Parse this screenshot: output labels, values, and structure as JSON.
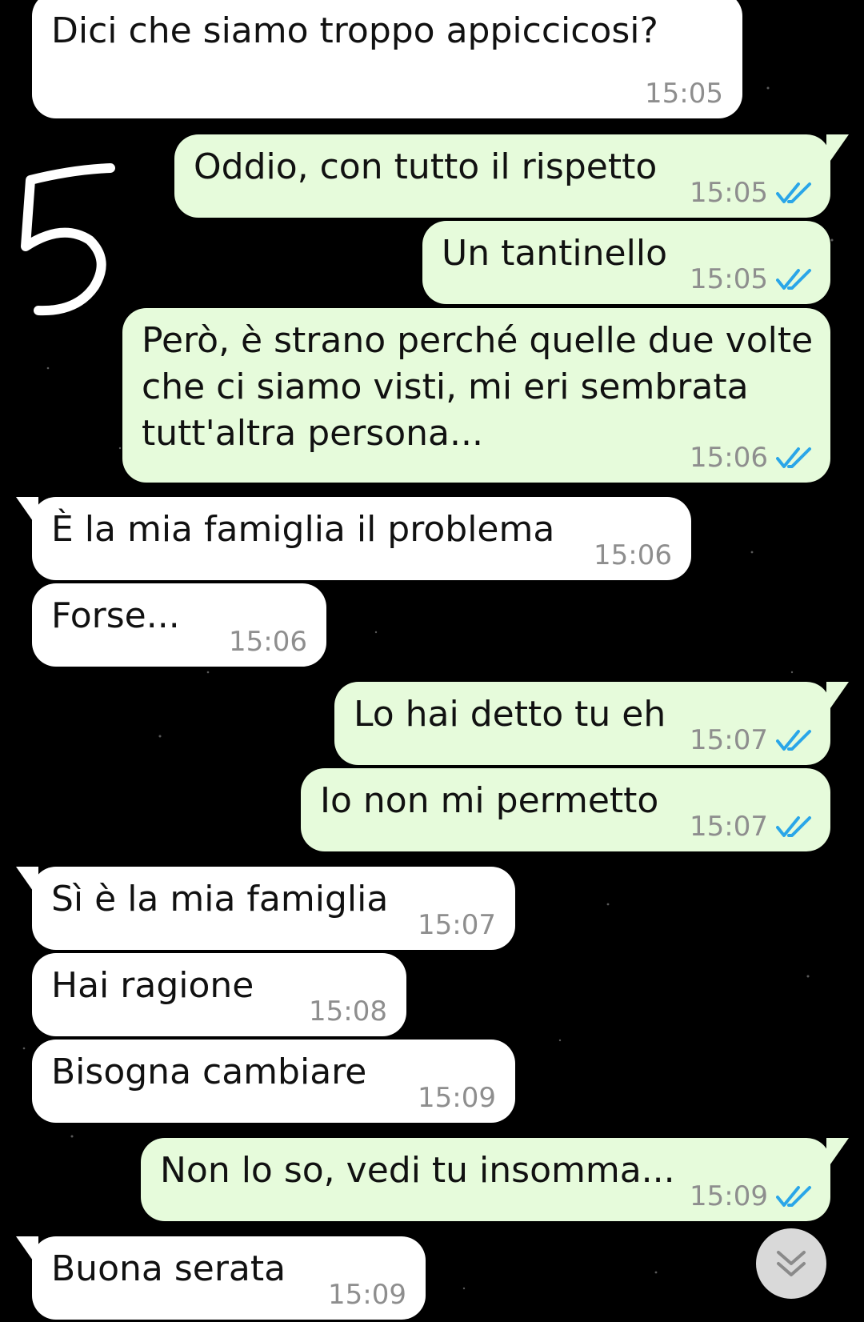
{
  "messages": [
    {
      "dir": "in",
      "text": "Dici che siamo troppo appiccicosi?",
      "time": "15:05"
    },
    {
      "dir": "out",
      "text": "Oddio, con tutto il rispetto",
      "time": "15:05",
      "status": "read"
    },
    {
      "dir": "out",
      "text": "Un tantinello",
      "time": "15:05",
      "status": "read"
    },
    {
      "dir": "out",
      "text": "Però, è strano perché quelle due volte\nche ci siamo visti, mi eri sembrata\ntutt'altra persona...",
      "time": "15:06",
      "status": "read"
    },
    {
      "dir": "in",
      "text": "È la mia famiglia il problema",
      "time": "15:06"
    },
    {
      "dir": "in",
      "text": "Forse...",
      "time": "15:06"
    },
    {
      "dir": "out",
      "text": "Lo hai detto tu eh",
      "time": "15:07",
      "status": "read"
    },
    {
      "dir": "out",
      "text": "Io non mi permetto",
      "time": "15:07",
      "status": "read"
    },
    {
      "dir": "in",
      "text": "Sì è la mia famiglia",
      "time": "15:07"
    },
    {
      "dir": "in",
      "text": "Hai ragione",
      "time": "15:08"
    },
    {
      "dir": "in",
      "text": "Bisogna cambiare",
      "time": "15:09"
    },
    {
      "dir": "out",
      "text": "Non lo so, vedi tu insomma...",
      "time": "15:09",
      "status": "read"
    },
    {
      "dir": "in",
      "text": "Buona serata",
      "time": "15:09"
    }
  ],
  "annotation": {
    "text": "5"
  },
  "icons": {
    "read_receipt": "double-check-icon",
    "scroll": "chevron-double-down-icon"
  },
  "colors": {
    "incoming": "#ffffff",
    "outgoing": "#e6fbdb",
    "tick": "#2aa6e8",
    "time": "#8e8e8e"
  }
}
